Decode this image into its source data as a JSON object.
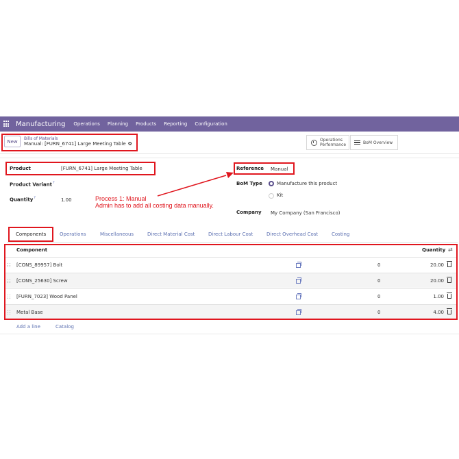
{
  "navbar": {
    "app_name": "Manufacturing",
    "menu": [
      "Operations",
      "Planning",
      "Products",
      "Reporting",
      "Configuration"
    ]
  },
  "control_panel": {
    "new_label": "New",
    "breadcrumb_root": "Bills of Materials",
    "breadcrumb_current": "Manual: [FURN_6741] Large Meeting Table",
    "smart_ops_label": "Operations Performance",
    "smart_bom_label": "BoM Overview"
  },
  "form": {
    "product_label": "Product",
    "product_value": "[FURN_6741] Large Meeting Table",
    "variant_label": "Product Variant",
    "quantity_label": "Quantity",
    "quantity_value": "1.00",
    "help_mark": "?",
    "reference_label": "Reference",
    "reference_value": "Manual",
    "bom_type_label": "BoM Type",
    "bom_type_options": [
      "Manufacture this product",
      "Kit"
    ],
    "bom_type_selected": "Manufacture this product",
    "company_label": "Company",
    "company_value": "My Company (San Francisco)"
  },
  "annotation": {
    "line1": "Process 1: Manual",
    "line2": "Admin has to add all costing data manually."
  },
  "tabs": [
    "Components",
    "Operations",
    "Miscellaneous",
    "Direct Material Cost",
    "Direct Labour Cost",
    "Direct Overhead Cost",
    "Costing"
  ],
  "active_tab": "Components",
  "table": {
    "headers": [
      "Component",
      "Quantity"
    ],
    "rows": [
      {
        "component": "[CONS_89957] Bolt",
        "extra": "0",
        "quantity": "20.00"
      },
      {
        "component": "[CONS_25630] Screw",
        "extra": "0",
        "quantity": "20.00"
      },
      {
        "component": "[FURN_7023] Wood Panel",
        "extra": "0",
        "quantity": "1.00"
      },
      {
        "component": "Metal Base",
        "extra": "0",
        "quantity": "4.00"
      }
    ],
    "add_line": "Add a line",
    "catalog": "Catalog"
  },
  "colors": {
    "navbar": "#71639e",
    "highlight": "#e0161e",
    "link": "#5b6fb0"
  }
}
